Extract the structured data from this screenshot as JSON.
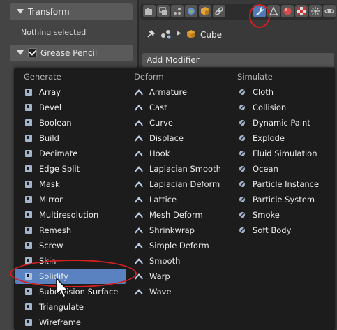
{
  "left_panel": {
    "transform_label": "Transform",
    "nothing_selected": "Nothing selected",
    "grease_pencil_label": "Grease Pencil"
  },
  "properties": {
    "object_name": "Cube",
    "add_modifier": "Add Modifier",
    "active_tab": "modifiers-wrench-icon"
  },
  "menu": {
    "generate": {
      "header": "Generate",
      "items": [
        "Array",
        "Bevel",
        "Boolean",
        "Build",
        "Decimate",
        "Edge Split",
        "Mask",
        "Mirror",
        "Multiresolution",
        "Remesh",
        "Screw",
        "Skin",
        "Solidify",
        "Subdivision Surface",
        "Triangulate",
        "Wireframe"
      ]
    },
    "deform": {
      "header": "Deform",
      "items": [
        "Armature",
        "Cast",
        "Curve",
        "Displace",
        "Hook",
        "Laplacian Smooth",
        "Laplacian Deform",
        "Lattice",
        "Mesh Deform",
        "Shrinkwrap",
        "Simple Deform",
        "Smooth",
        "Warp",
        "Wave"
      ]
    },
    "simulate": {
      "header": "Simulate",
      "items": [
        "Cloth",
        "Collision",
        "Dynamic Paint",
        "Explode",
        "Fluid Simulation",
        "Ocean",
        "Particle Instance",
        "Particle System",
        "Smoke",
        "Soft Body"
      ]
    },
    "highlighted_item": "Solidify"
  },
  "colors": {
    "highlight": "#5b82c0",
    "annotation_ring": "#d31f1f",
    "menu_bg": "#1c1c1c"
  }
}
